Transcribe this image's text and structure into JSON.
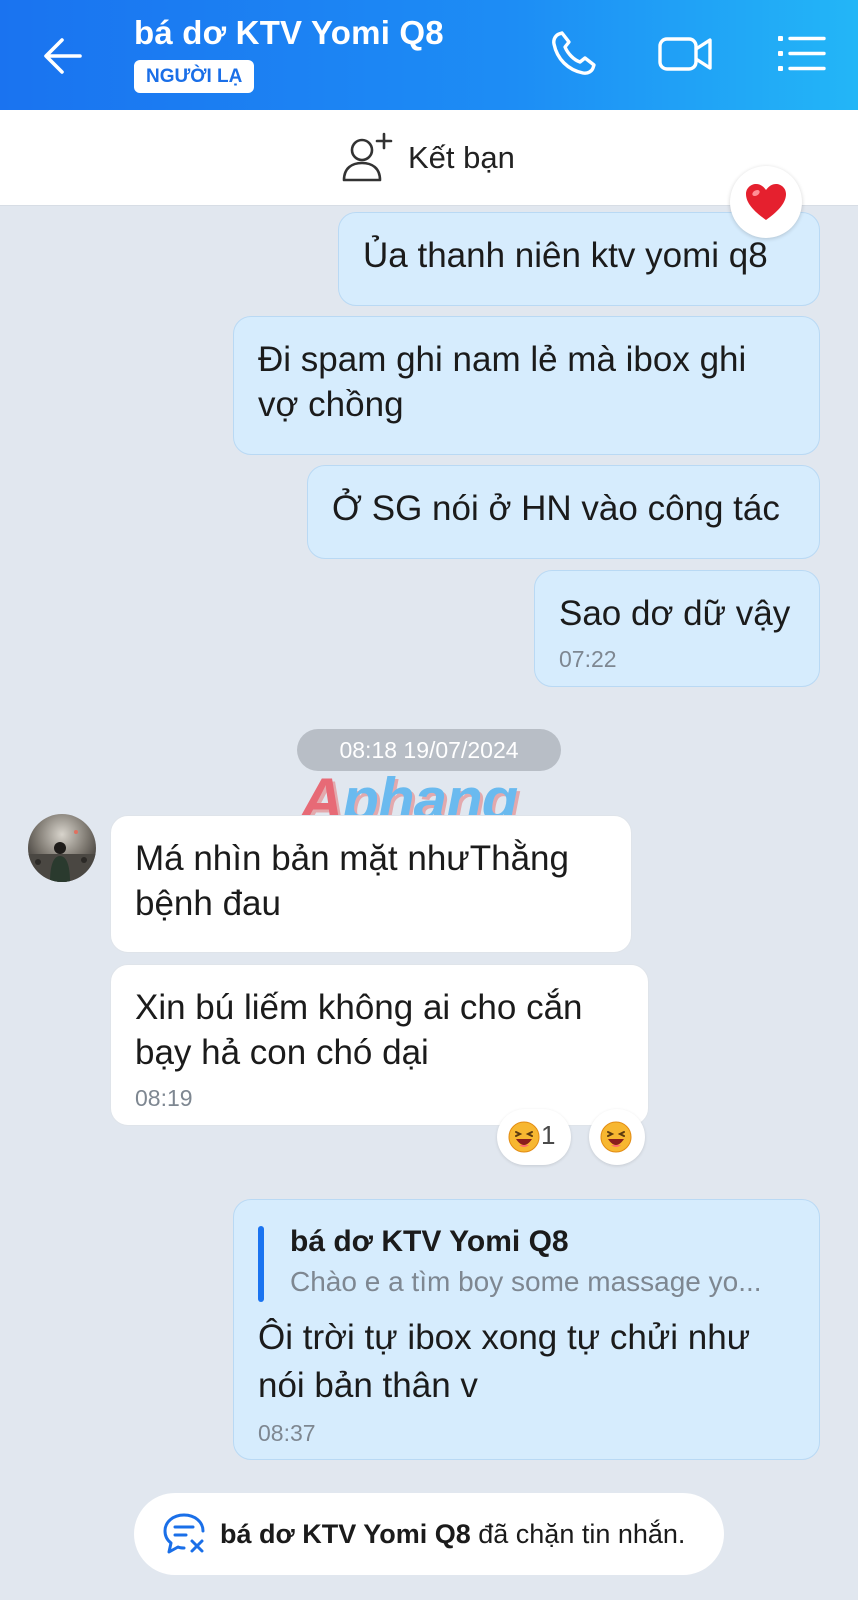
{
  "header": {
    "title": "bá dơ KTV Yomi Q8",
    "badge": "NGƯỜI LẠ"
  },
  "add_friend": {
    "label": "Kết bạn"
  },
  "messages_before": [
    {
      "text": "Ủa thanh niên ktv yomi q8"
    },
    {
      "text": "Đi spam ghi nam lẻ mà ibox ghi vợ chồng"
    },
    {
      "text": "Ở SG nói ở HN vào công tác"
    },
    {
      "text": "Sao dơ dữ vậy",
      "time": "07:22"
    }
  ],
  "time_divider": "08:18 19/07/2024",
  "watermark": {
    "first": "A",
    "rest": "phang"
  },
  "messages_received": [
    {
      "text": "Má nhìn bản mặt nhưThằng bệnh đau"
    },
    {
      "text": "Xin bú liếm không ai cho cắn bạy hả con chó dại",
      "time": "08:19"
    }
  ],
  "reactions": {
    "laugh_count": "1"
  },
  "reply": {
    "quoted_author": "bá dơ KTV Yomi Q8",
    "quoted_text": "Chào e a tìm boy some massage yo...",
    "text": "Ôi trời tự ibox xong tự chửi như nói bản thân v",
    "time": "08:37"
  },
  "blocked": {
    "name": "bá dơ KTV Yomi Q8",
    "suffix": " đã chặn tin nhắn."
  },
  "colors": {
    "header_start": "#1a73f0",
    "header_end": "#23b6f7",
    "sent_bubble": "#d6ecfd",
    "recv_bubble": "#ffffff",
    "background": "#e1e7ef"
  }
}
